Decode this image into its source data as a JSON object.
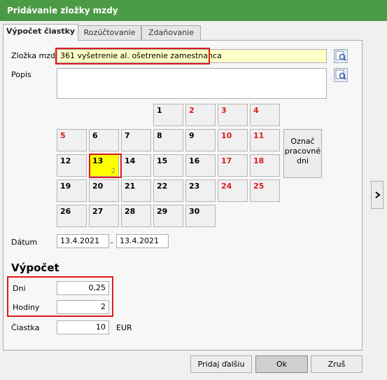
{
  "window": {
    "title": "Pridávanie zložky mzdy"
  },
  "tabs": [
    {
      "label": "Výpočet čiastky"
    },
    {
      "label": "Rozúčtovanie"
    },
    {
      "label": "Zdaňovanie"
    }
  ],
  "form": {
    "zlozka_label": "Zložka mzdy",
    "zlozka_value": "361  vyšetrenie al. ošetrenie zamestnanca",
    "popis_label": "Popis",
    "popis_value": "",
    "datum_label": "Dátum",
    "date_from": "13.4.2021",
    "date_sep": "-",
    "date_to": "13.4.2021"
  },
  "calendar": {
    "days": [
      {
        "d": "1"
      },
      {
        "d": "2",
        "red": true
      },
      {
        "d": "3",
        "red": true
      },
      {
        "d": "4",
        "red": true
      },
      {
        "d": "5",
        "red": true
      },
      {
        "d": "6"
      },
      {
        "d": "7"
      },
      {
        "d": "8"
      },
      {
        "d": "9"
      },
      {
        "d": "10",
        "red": true
      },
      {
        "d": "11",
        "red": true
      },
      {
        "d": "12"
      },
      {
        "d": "13",
        "selected": true,
        "sub": "2"
      },
      {
        "d": "14"
      },
      {
        "d": "15"
      },
      {
        "d": "16"
      },
      {
        "d": "17",
        "red": true
      },
      {
        "d": "18",
        "red": true
      },
      {
        "d": "19"
      },
      {
        "d": "20"
      },
      {
        "d": "21"
      },
      {
        "d": "22"
      },
      {
        "d": "23"
      },
      {
        "d": "24",
        "red": true
      },
      {
        "d": "25",
        "red": true
      },
      {
        "d": "26"
      },
      {
        "d": "27"
      },
      {
        "d": "28"
      },
      {
        "d": "29"
      },
      {
        "d": "30"
      }
    ],
    "mark_button": [
      "Označ",
      "pracovné",
      "dni"
    ]
  },
  "vypocet": {
    "heading": "Výpočet",
    "dni_label": "Dni",
    "dni_value": "0,25",
    "hodiny_label": "Hodiny",
    "hodiny_value": "2",
    "ciastka_label": "Čiastka",
    "ciastka_value": "10",
    "currency": "EUR"
  },
  "buttons": {
    "add_next": "Pridaj ďalšiu",
    "ok": "Ok",
    "cancel": "Zruš"
  },
  "icons": {
    "lookup": "search-icon",
    "expand": "chevron-right-icon"
  },
  "colors": {
    "titlebar": "#4b9a46",
    "highlight": "#e01a1a",
    "weekend": "#e01a1a",
    "selected_day": "#ffff00"
  }
}
